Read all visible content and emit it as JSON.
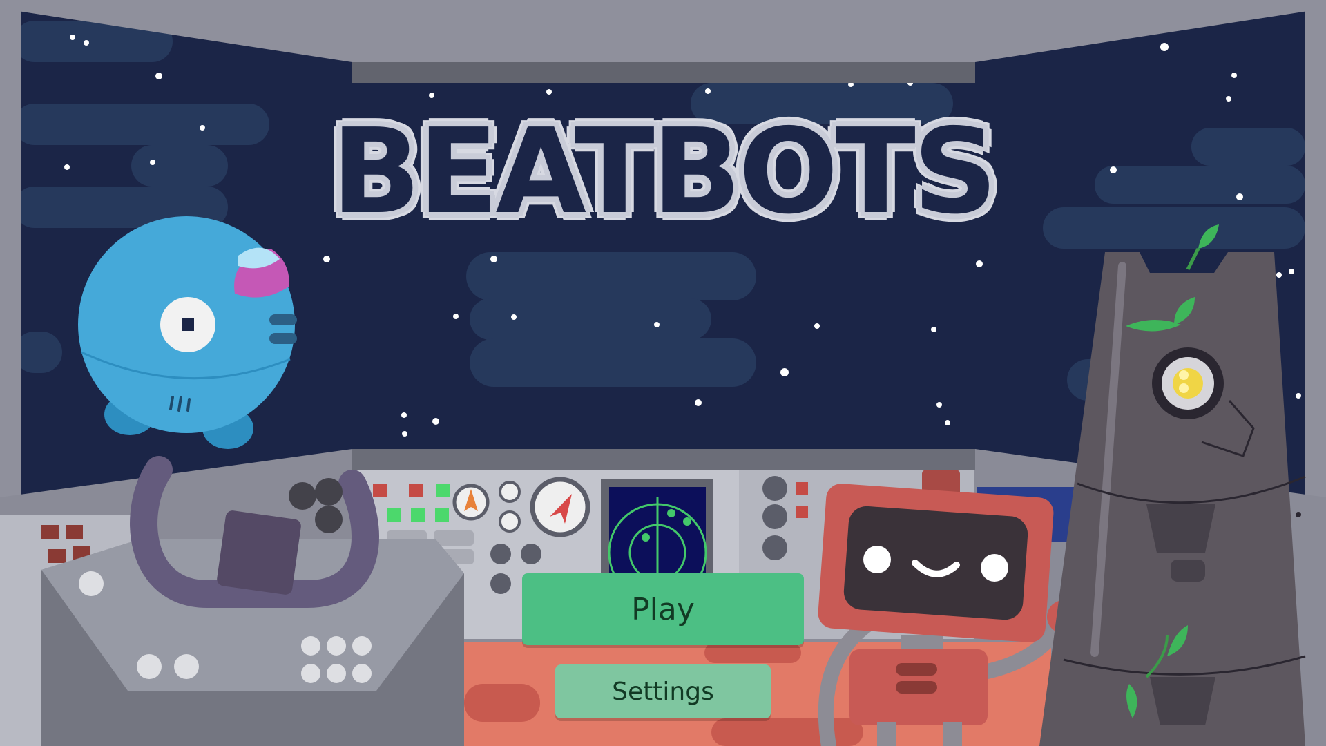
{
  "game": {
    "title": "BEATBOTS"
  },
  "menu": {
    "play_label": "Play",
    "settings_label": "Settings"
  },
  "colors": {
    "space": "#1b2547",
    "cloud": "#26395c",
    "play_button": "#4cbf84",
    "settings_button": "#7fc6a0",
    "frame": "#8f909c",
    "blue_robot": "#45a9d9",
    "red_robot": "#c85a55",
    "tower_robot": "#5d575f"
  }
}
